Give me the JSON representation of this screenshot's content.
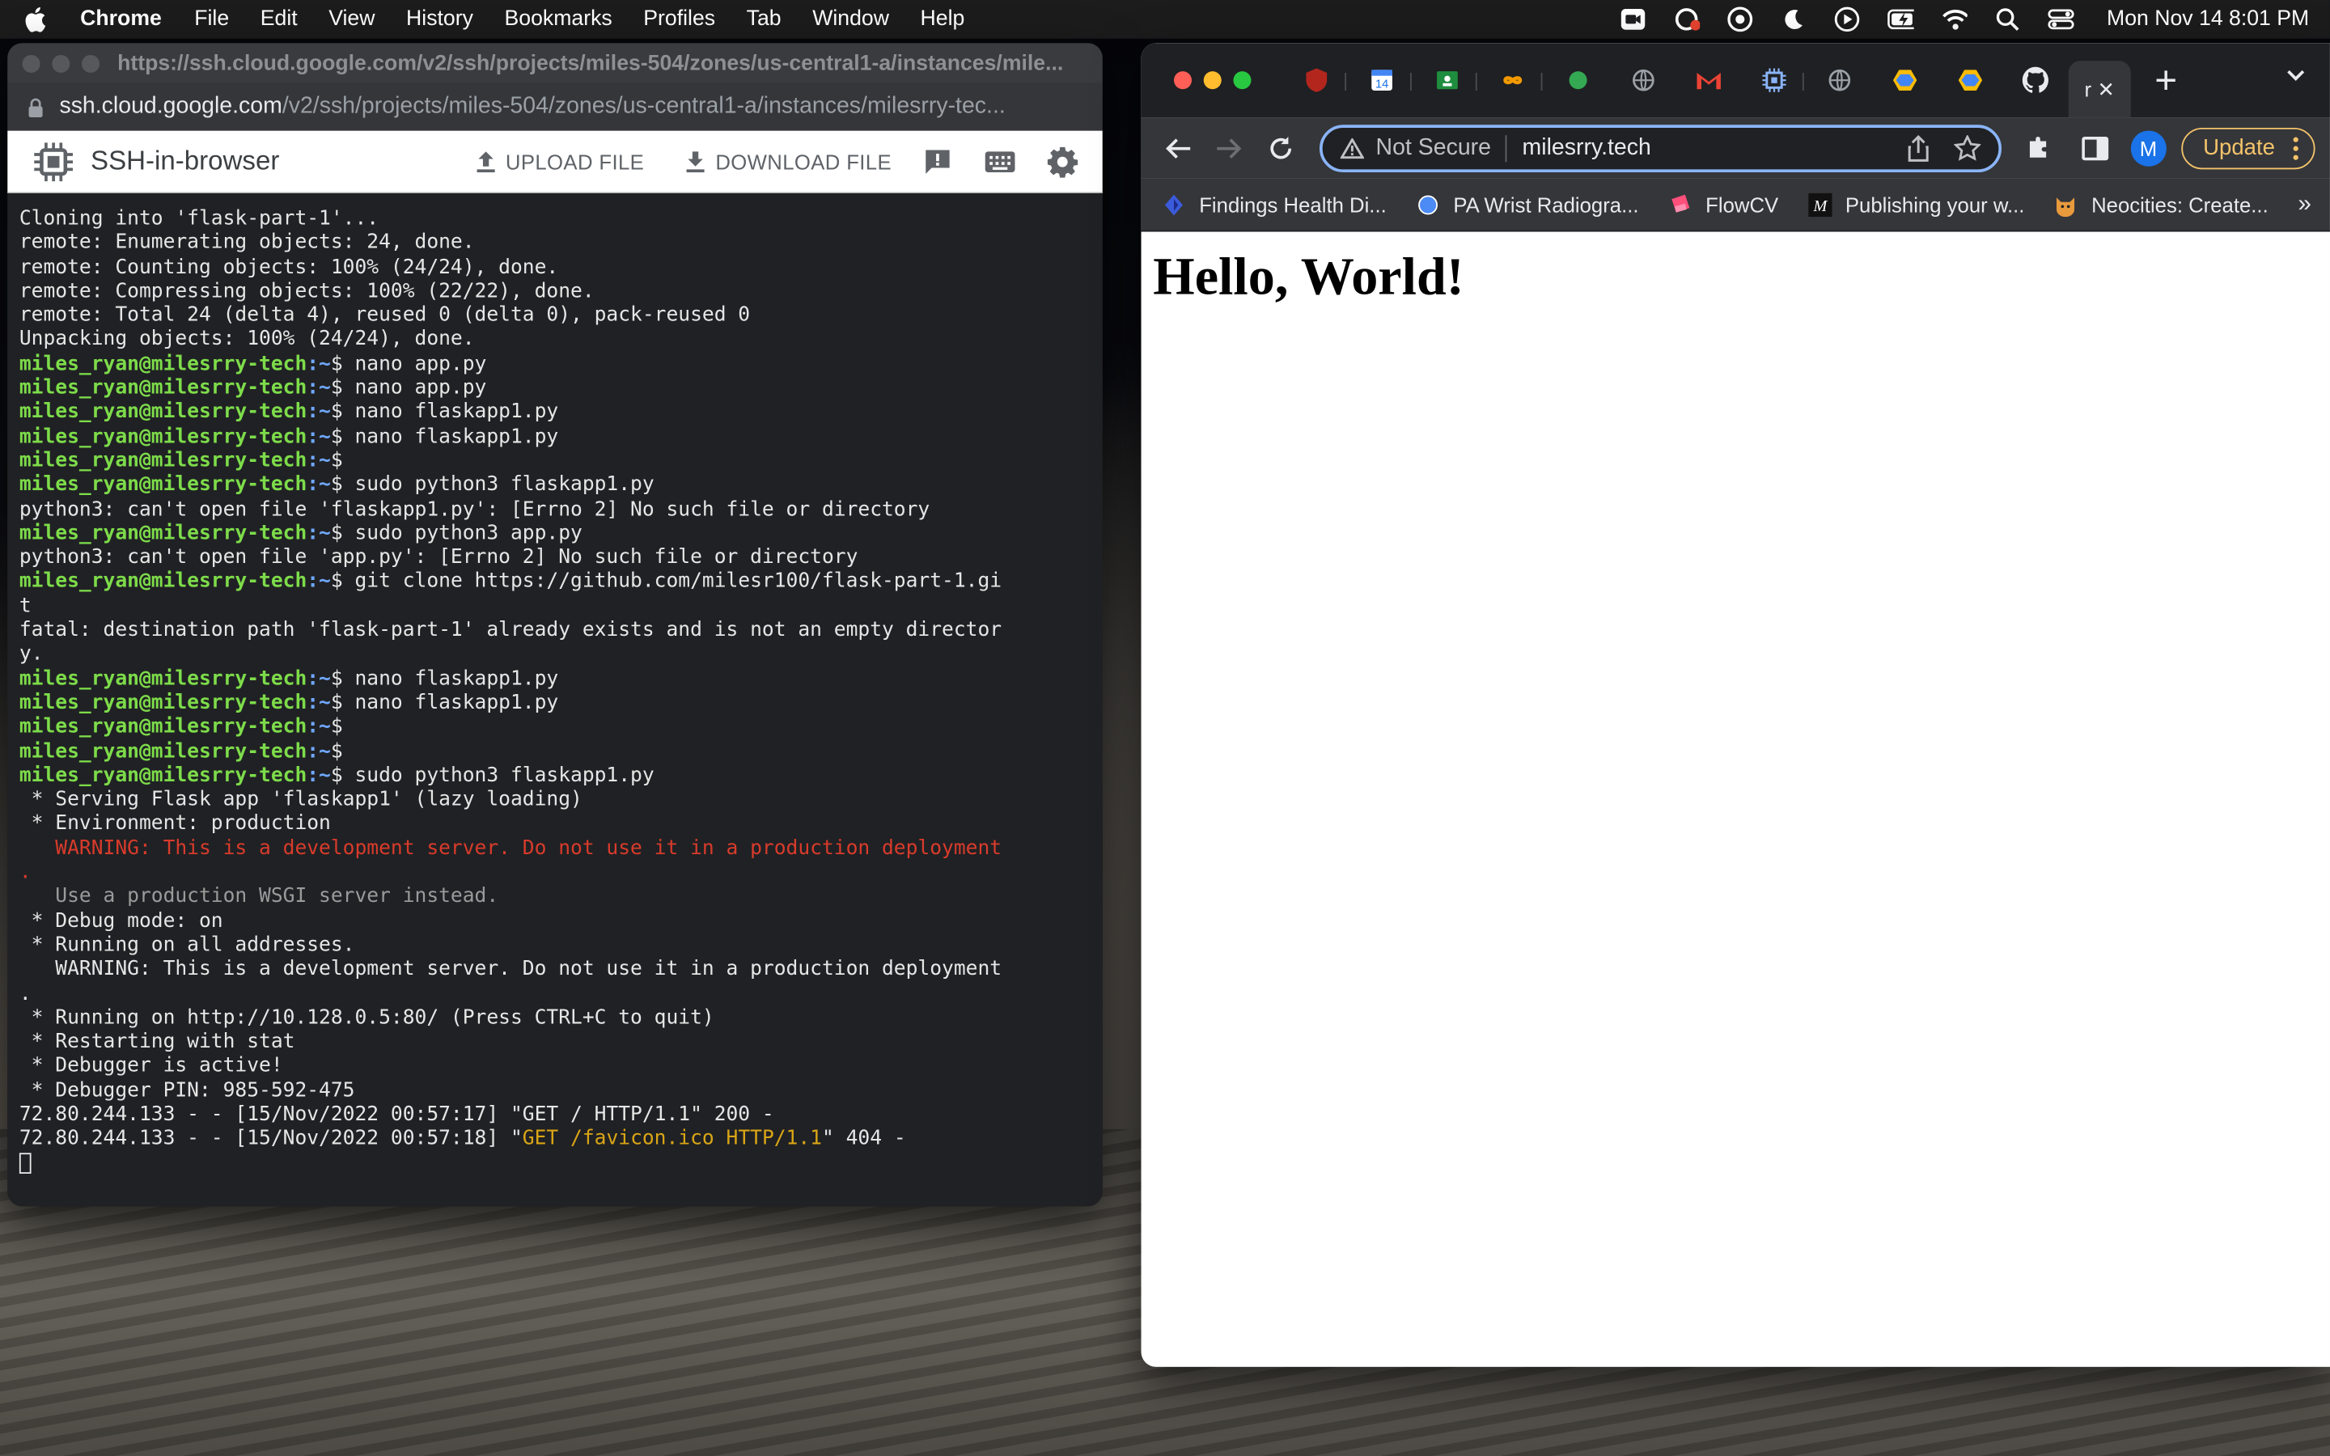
{
  "menubar": {
    "app_name": "Chrome",
    "items": [
      "File",
      "Edit",
      "View",
      "History",
      "Bookmarks",
      "Profiles",
      "Tab",
      "Window",
      "Help"
    ],
    "clock": "Mon Nov 14  8:01 PM"
  },
  "ssh_window": {
    "title_url": "https://ssh.cloud.google.com/v2/ssh/projects/miles-504/zones/us-central1-a/instances/mile...",
    "url_host": "ssh.cloud.google.com",
    "url_path": "/v2/ssh/projects/miles-504/zones/us-central1-a/instances/milesrry-tec...",
    "brand": "SSH-in-browser",
    "upload_label": "UPLOAD FILE",
    "download_label": "DOWNLOAD FILE",
    "prompt_user": "miles_ryan@milesrry-tech",
    "prompt_path": ":~",
    "terminal": [
      {
        "type": "out",
        "text": "Cloning into 'flask-part-1'..."
      },
      {
        "type": "out",
        "text": "remote: Enumerating objects: 24, done."
      },
      {
        "type": "out",
        "text": "remote: Counting objects: 100% (24/24), done."
      },
      {
        "type": "out",
        "text": "remote: Compressing objects: 100% (22/22), done."
      },
      {
        "type": "out",
        "text": "remote: Total 24 (delta 4), reused 0 (delta 0), pack-reused 0"
      },
      {
        "type": "out",
        "text": "Unpacking objects: 100% (24/24), done."
      },
      {
        "type": "prompt",
        "cmd": "$ nano app.py"
      },
      {
        "type": "prompt",
        "cmd": "$ nano app.py"
      },
      {
        "type": "prompt",
        "cmd": "$ nano flaskapp1.py"
      },
      {
        "type": "prompt",
        "cmd": "$ nano flaskapp1.py"
      },
      {
        "type": "prompt",
        "cmd": "$"
      },
      {
        "type": "prompt",
        "cmd": "$ sudo python3 flaskapp1.py"
      },
      {
        "type": "out",
        "text": "python3: can't open file 'flaskapp1.py': [Errno 2] No such file or directory"
      },
      {
        "type": "prompt",
        "cmd": "$ sudo python3 app.py"
      },
      {
        "type": "out",
        "text": "python3: can't open file 'app.py': [Errno 2] No such file or directory"
      },
      {
        "type": "prompt",
        "cmd": "$ git clone https://github.com/milesr100/flask-part-1.gi"
      },
      {
        "type": "out",
        "text": "t"
      },
      {
        "type": "out",
        "text": "fatal: destination path 'flask-part-1' already exists and is not an empty director"
      },
      {
        "type": "out",
        "text": "y."
      },
      {
        "type": "prompt",
        "cmd": "$ nano flaskapp1.py"
      },
      {
        "type": "prompt",
        "cmd": "$ nano flaskapp1.py"
      },
      {
        "type": "prompt",
        "cmd": "$"
      },
      {
        "type": "prompt",
        "cmd": "$"
      },
      {
        "type": "prompt",
        "cmd": "$ sudo python3 flaskapp1.py"
      },
      {
        "type": "out",
        "text": " * Serving Flask app 'flaskapp1' (lazy loading)"
      },
      {
        "type": "out",
        "text": " * Environment: production"
      },
      {
        "type": "red",
        "text": "   WARNING: This is a development server. Do not use it in a production deployment"
      },
      {
        "type": "red",
        "text": "."
      },
      {
        "type": "gray",
        "text": "   Use a production WSGI server instead."
      },
      {
        "type": "out",
        "text": " * Debug mode: on"
      },
      {
        "type": "out",
        "text": " * Running on all addresses."
      },
      {
        "type": "out",
        "text": "   WARNING: This is a development server. Do not use it in a production deployment"
      },
      {
        "type": "out",
        "text": "."
      },
      {
        "type": "out",
        "text": " * Running on http://10.128.0.5:80/ (Press CTRL+C to quit)"
      },
      {
        "type": "out",
        "text": " * Restarting with stat"
      },
      {
        "type": "out",
        "text": " * Debugger is active!"
      },
      {
        "type": "out",
        "text": " * Debugger PIN: 985-592-475"
      },
      {
        "type": "out",
        "text": "72.80.244.133 - - [15/Nov/2022 00:57:17] \"GET / HTTP/1.1\" 200 -"
      },
      {
        "type": "log404",
        "pre": "72.80.244.133 - - [15/Nov/2022 00:57:18] \"",
        "hl": "GET /favicon.ico HTTP/1.1",
        "post": "\" 404 -"
      }
    ]
  },
  "chrome": {
    "active_tab_label": "r",
    "not_secure": "Not Secure",
    "url": "milesrry.tech",
    "profile_initial": "M",
    "update_label": "Update",
    "bookmarks": [
      {
        "label": "Findings Health Di...",
        "icon": "findings-icon"
      },
      {
        "label": "PA Wrist Radiogra...",
        "icon": "blue-dot-icon"
      },
      {
        "label": "FlowCV",
        "icon": "flowcv-icon"
      },
      {
        "label": "Publishing your w...",
        "icon": "medium-icon"
      },
      {
        "label": "Neocities: Create...",
        "icon": "neocities-cat-icon"
      }
    ],
    "bookmarks_more": "»",
    "page_heading": "Hello, World!"
  },
  "colors": {
    "terminal_bg": "#202124",
    "prompt_user": "#7ddc4a",
    "prompt_path": "#6fa8ff",
    "warning_red": "#d83b2b",
    "update_accent": "#f4c46a",
    "omnibox_focus": "#8ab4f8"
  }
}
